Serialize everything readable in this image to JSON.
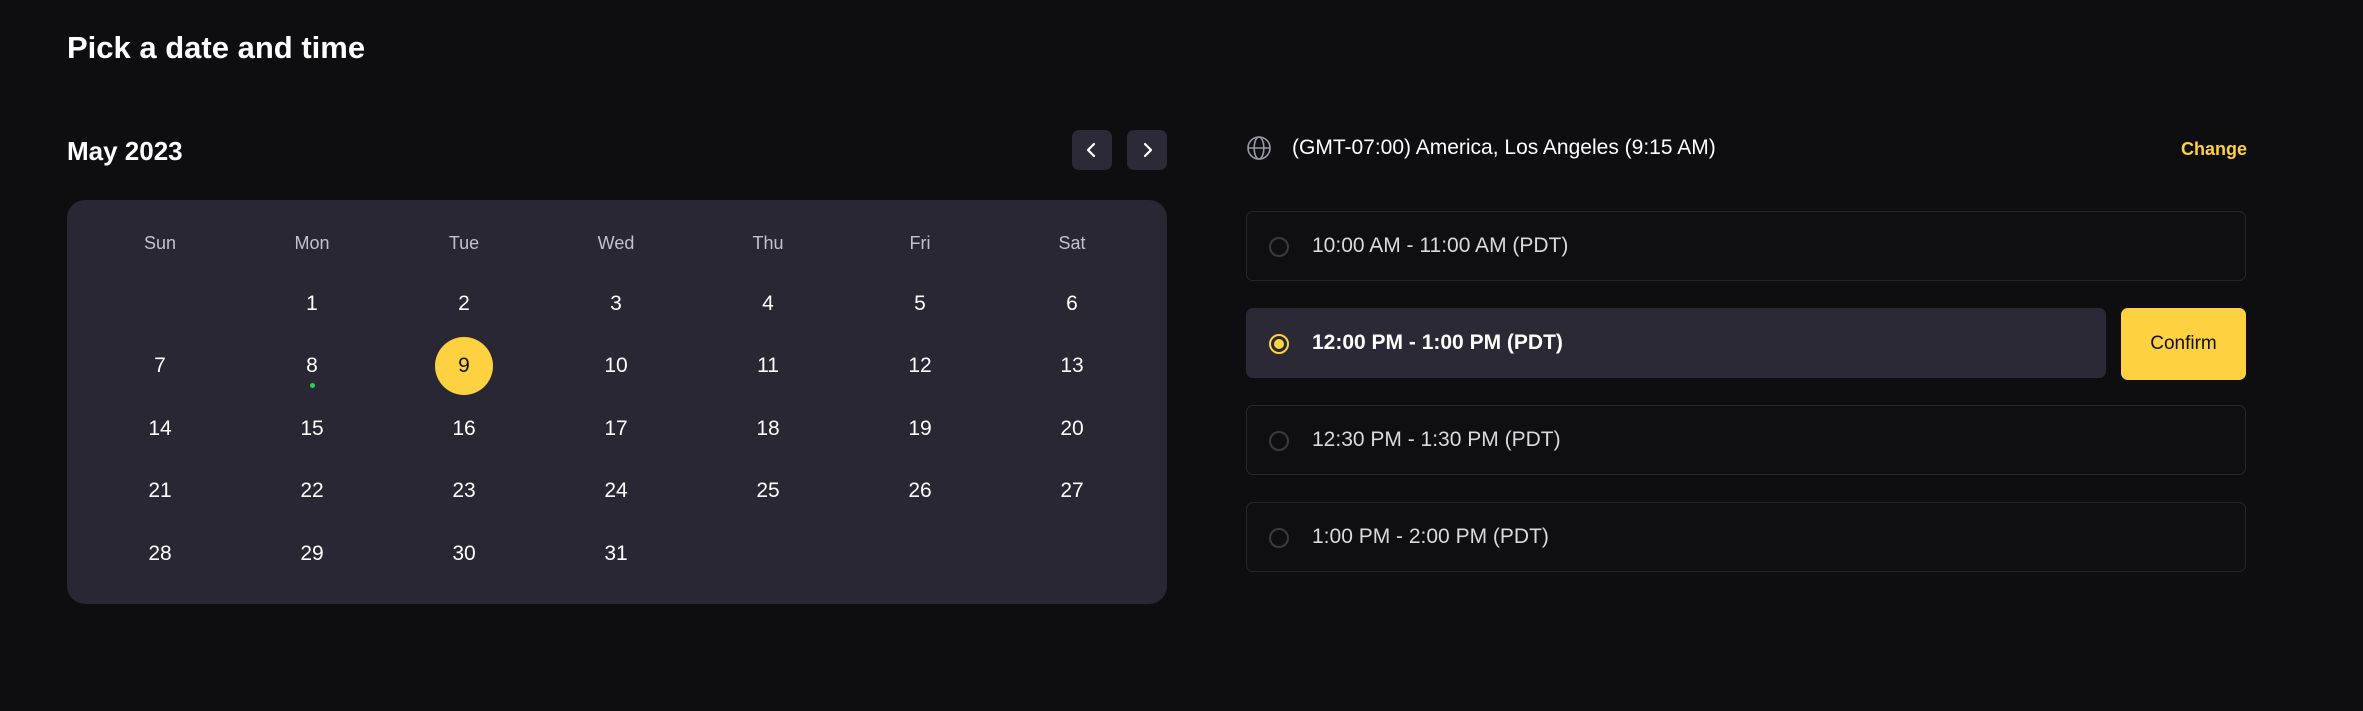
{
  "page": {
    "title": "Pick a date and time"
  },
  "calendar": {
    "month_label": "May 2023",
    "prev_icon": "chevron-left-icon",
    "next_icon": "chevron-right-icon",
    "weekdays": [
      "Sun",
      "Mon",
      "Tue",
      "Wed",
      "Thu",
      "Fri",
      "Sat"
    ],
    "weeks": [
      [
        "",
        "1",
        "2",
        "3",
        "4",
        "5",
        "6"
      ],
      [
        "7",
        "8",
        "9",
        "10",
        "11",
        "12",
        "13"
      ],
      [
        "14",
        "15",
        "16",
        "17",
        "18",
        "19",
        "20"
      ],
      [
        "21",
        "22",
        "23",
        "24",
        "25",
        "26",
        "27"
      ],
      [
        "28",
        "29",
        "30",
        "31",
        "",
        "",
        ""
      ]
    ],
    "selected_day": "9",
    "marked_day": "8"
  },
  "timezone": {
    "icon": "globe-icon",
    "text": "(GMT-07:00) America, Los Angeles (9:15 AM)",
    "change_label": "Change"
  },
  "slots": [
    {
      "label": "10:00 AM - 11:00 AM (PDT)",
      "selected": false
    },
    {
      "label": "12:00 PM - 1:00 PM (PDT)",
      "selected": true
    },
    {
      "label": "12:30 PM - 1:30 PM (PDT)",
      "selected": false
    },
    {
      "label": "1:00 PM - 2:00 PM (PDT)",
      "selected": false
    }
  ],
  "confirm_label": "Confirm",
  "colors": {
    "accent": "#fdd13f",
    "background": "#0e0e10",
    "card": "#282733",
    "dot": "#2fce5b"
  }
}
